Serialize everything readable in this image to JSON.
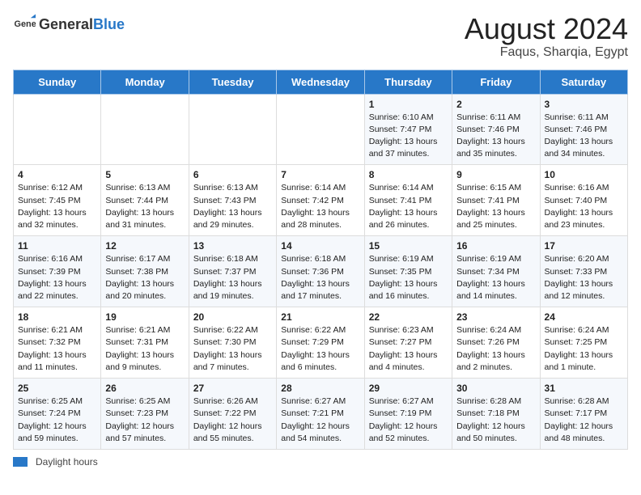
{
  "header": {
    "logo_general": "General",
    "logo_blue": "Blue",
    "main_title": "August 2024",
    "sub_title": "Faqus, Sharqia, Egypt"
  },
  "days_of_week": [
    "Sunday",
    "Monday",
    "Tuesday",
    "Wednesday",
    "Thursday",
    "Friday",
    "Saturday"
  ],
  "weeks": [
    [
      {
        "day": "",
        "content": ""
      },
      {
        "day": "",
        "content": ""
      },
      {
        "day": "",
        "content": ""
      },
      {
        "day": "",
        "content": ""
      },
      {
        "day": "1",
        "content": "Sunrise: 6:10 AM\nSunset: 7:47 PM\nDaylight: 13 hours and 37 minutes."
      },
      {
        "day": "2",
        "content": "Sunrise: 6:11 AM\nSunset: 7:46 PM\nDaylight: 13 hours and 35 minutes."
      },
      {
        "day": "3",
        "content": "Sunrise: 6:11 AM\nSunset: 7:46 PM\nDaylight: 13 hours and 34 minutes."
      }
    ],
    [
      {
        "day": "4",
        "content": "Sunrise: 6:12 AM\nSunset: 7:45 PM\nDaylight: 13 hours and 32 minutes."
      },
      {
        "day": "5",
        "content": "Sunrise: 6:13 AM\nSunset: 7:44 PM\nDaylight: 13 hours and 31 minutes."
      },
      {
        "day": "6",
        "content": "Sunrise: 6:13 AM\nSunset: 7:43 PM\nDaylight: 13 hours and 29 minutes."
      },
      {
        "day": "7",
        "content": "Sunrise: 6:14 AM\nSunset: 7:42 PM\nDaylight: 13 hours and 28 minutes."
      },
      {
        "day": "8",
        "content": "Sunrise: 6:14 AM\nSunset: 7:41 PM\nDaylight: 13 hours and 26 minutes."
      },
      {
        "day": "9",
        "content": "Sunrise: 6:15 AM\nSunset: 7:41 PM\nDaylight: 13 hours and 25 minutes."
      },
      {
        "day": "10",
        "content": "Sunrise: 6:16 AM\nSunset: 7:40 PM\nDaylight: 13 hours and 23 minutes."
      }
    ],
    [
      {
        "day": "11",
        "content": "Sunrise: 6:16 AM\nSunset: 7:39 PM\nDaylight: 13 hours and 22 minutes."
      },
      {
        "day": "12",
        "content": "Sunrise: 6:17 AM\nSunset: 7:38 PM\nDaylight: 13 hours and 20 minutes."
      },
      {
        "day": "13",
        "content": "Sunrise: 6:18 AM\nSunset: 7:37 PM\nDaylight: 13 hours and 19 minutes."
      },
      {
        "day": "14",
        "content": "Sunrise: 6:18 AM\nSunset: 7:36 PM\nDaylight: 13 hours and 17 minutes."
      },
      {
        "day": "15",
        "content": "Sunrise: 6:19 AM\nSunset: 7:35 PM\nDaylight: 13 hours and 16 minutes."
      },
      {
        "day": "16",
        "content": "Sunrise: 6:19 AM\nSunset: 7:34 PM\nDaylight: 13 hours and 14 minutes."
      },
      {
        "day": "17",
        "content": "Sunrise: 6:20 AM\nSunset: 7:33 PM\nDaylight: 13 hours and 12 minutes."
      }
    ],
    [
      {
        "day": "18",
        "content": "Sunrise: 6:21 AM\nSunset: 7:32 PM\nDaylight: 13 hours and 11 minutes."
      },
      {
        "day": "19",
        "content": "Sunrise: 6:21 AM\nSunset: 7:31 PM\nDaylight: 13 hours and 9 minutes."
      },
      {
        "day": "20",
        "content": "Sunrise: 6:22 AM\nSunset: 7:30 PM\nDaylight: 13 hours and 7 minutes."
      },
      {
        "day": "21",
        "content": "Sunrise: 6:22 AM\nSunset: 7:29 PM\nDaylight: 13 hours and 6 minutes."
      },
      {
        "day": "22",
        "content": "Sunrise: 6:23 AM\nSunset: 7:27 PM\nDaylight: 13 hours and 4 minutes."
      },
      {
        "day": "23",
        "content": "Sunrise: 6:24 AM\nSunset: 7:26 PM\nDaylight: 13 hours and 2 minutes."
      },
      {
        "day": "24",
        "content": "Sunrise: 6:24 AM\nSunset: 7:25 PM\nDaylight: 13 hours and 1 minute."
      }
    ],
    [
      {
        "day": "25",
        "content": "Sunrise: 6:25 AM\nSunset: 7:24 PM\nDaylight: 12 hours and 59 minutes."
      },
      {
        "day": "26",
        "content": "Sunrise: 6:25 AM\nSunset: 7:23 PM\nDaylight: 12 hours and 57 minutes."
      },
      {
        "day": "27",
        "content": "Sunrise: 6:26 AM\nSunset: 7:22 PM\nDaylight: 12 hours and 55 minutes."
      },
      {
        "day": "28",
        "content": "Sunrise: 6:27 AM\nSunset: 7:21 PM\nDaylight: 12 hours and 54 minutes."
      },
      {
        "day": "29",
        "content": "Sunrise: 6:27 AM\nSunset: 7:19 PM\nDaylight: 12 hours and 52 minutes."
      },
      {
        "day": "30",
        "content": "Sunrise: 6:28 AM\nSunset: 7:18 PM\nDaylight: 12 hours and 50 minutes."
      },
      {
        "day": "31",
        "content": "Sunrise: 6:28 AM\nSunset: 7:17 PM\nDaylight: 12 hours and 48 minutes."
      }
    ]
  ],
  "footer": {
    "daylight_label": "Daylight hours"
  }
}
